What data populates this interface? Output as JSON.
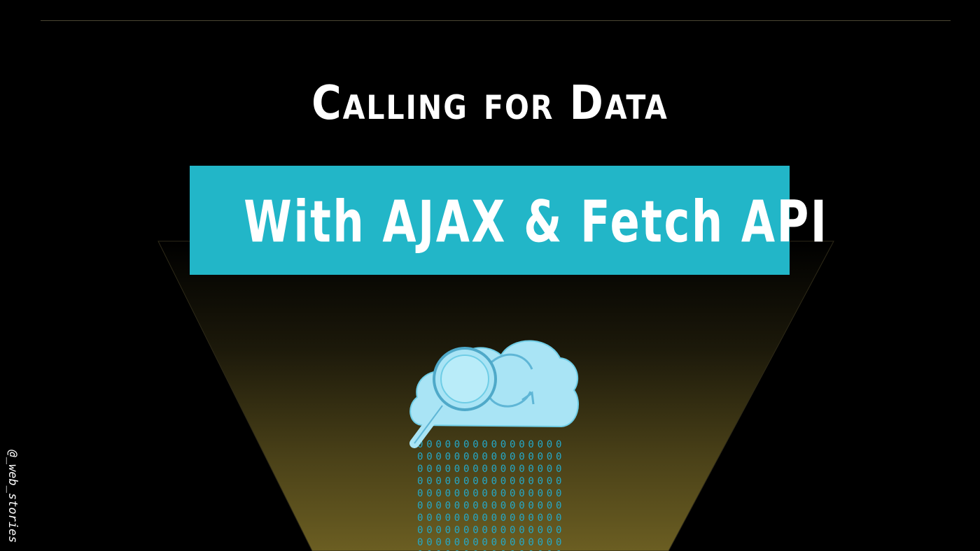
{
  "title": "Calling for Data",
  "banner": {
    "text": "With AJAX & Fetch API",
    "color": "#22b6c8"
  },
  "handle": "@_web_stories",
  "illustration": {
    "icons": [
      "cloud-icon",
      "magnifying-glass-icon",
      "refresh-arrow-icon",
      "binary-data-stream-icon"
    ],
    "cloud_color": "#a9e4f5",
    "stream_color": "#24a9c9"
  },
  "colors": {
    "background": "#000000",
    "funnel_glow": "#6b5e22",
    "text": "#ffffff"
  }
}
